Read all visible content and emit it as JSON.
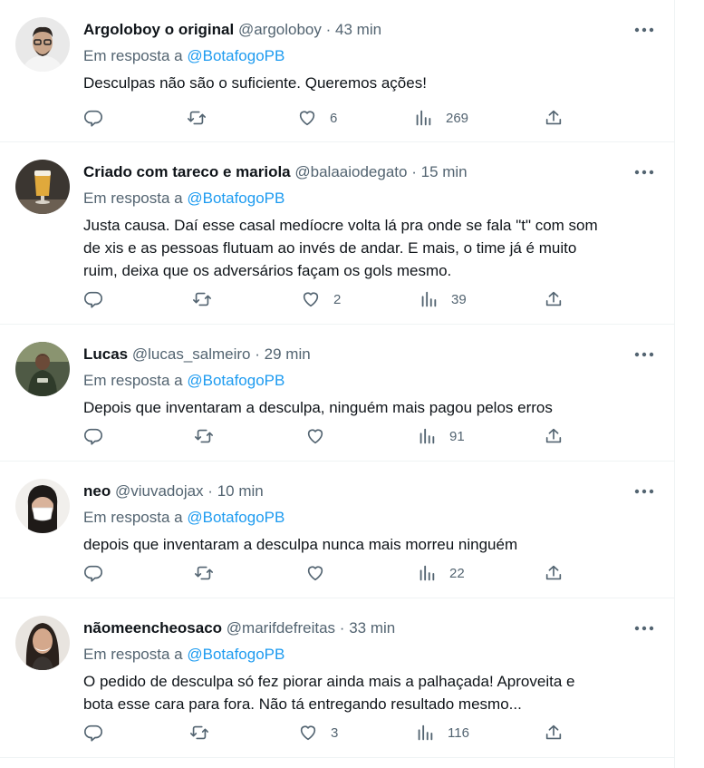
{
  "reply_prefix": "Em resposta a",
  "tweets": [
    {
      "name": "Argoloboy o original",
      "handle": "@argoloboy",
      "dot": "·",
      "time": "43 min",
      "reply_to": "@BotafogoPB",
      "lines": [
        "Desculpas não são o suficiente. Queremos ações!"
      ],
      "likes": "6",
      "views": "269",
      "avatar_icon": "man-with-glasses-avatar"
    },
    {
      "name": "Criado com tareco e mariola",
      "handle": "@balaaiodegato",
      "dot": "·",
      "time": "15 min",
      "reply_to": "@BotafogoPB",
      "lines": [
        "Justa causa. Daí esse casal medíocre volta lá pra onde se fala \"t\" com som",
        "de xis e as pessoas flutuam ao invés de andar. E mais, o time já é muito",
        "ruim, deixa que os adversários façam os gols mesmo."
      ],
      "likes": "2",
      "views": "39",
      "avatar_icon": "beer-glass-avatar"
    },
    {
      "name": "Lucas",
      "handle": "@lucas_salmeiro",
      "dot": "·",
      "time": "29 min",
      "reply_to": "@BotafogoPB",
      "lines": [
        "Depois que inventaram a desculpa, ninguém mais pagou pelos erros"
      ],
      "likes": "",
      "views": "91",
      "avatar_icon": "man-sitting-avatar"
    },
    {
      "name": "neo",
      "handle": "@viuvadojax",
      "dot": "·",
      "time": "10 min",
      "reply_to": "@BotafogoPB",
      "lines": [
        "depois que inventaram a desculpa nunca mais morreu ninguém"
      ],
      "likes": "",
      "views": "22",
      "avatar_icon": "person-with-mask-avatar"
    },
    {
      "name": "nãomeencheosaco",
      "handle": "@marifdefreitas",
      "dot": "·",
      "time": "33 min",
      "reply_to": "@BotafogoPB",
      "lines": [
        "O pedido de desculpa só fez piorar ainda mais a palhaçada! Aproveita e",
        "bota esse cara para fora. Não tá entregando resultado mesmo..."
      ],
      "likes": "3",
      "views": "116",
      "avatar_icon": "woman-avatar"
    }
  ]
}
